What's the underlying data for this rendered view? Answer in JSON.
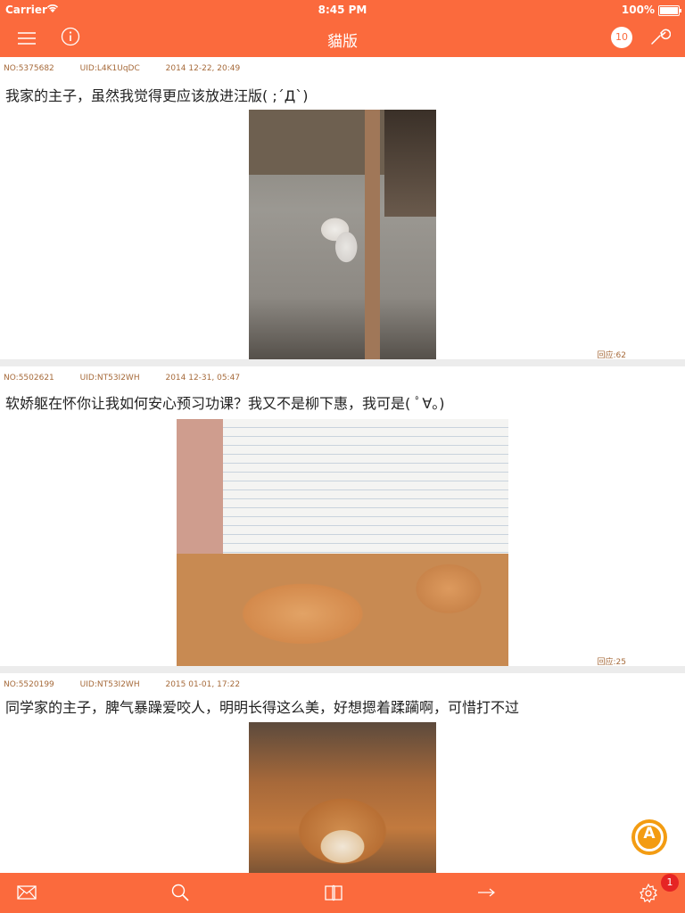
{
  "status_bar": {
    "carrier": "Carrier",
    "time": "8:45 PM",
    "battery": "100%"
  },
  "nav_bar": {
    "title": "貓版",
    "notification_count": "10"
  },
  "posts": [
    {
      "no": "NO:5375682",
      "uid": "UID:L4K1UqDC",
      "date": "2014 12-22, 20:49",
      "text": "我家的主子，虽然我觉得更应该放进汪版( ;´Д`)",
      "replies": "回应:62"
    },
    {
      "no": "NO:5502621",
      "uid": "UID:NT53I2WH",
      "date": "2014 12-31, 05:47",
      "text": "软娇躯在怀你让我如何安心预习功课？我又不是柳下惠，我可是( ﾟ∀。)",
      "replies": "回应:25"
    },
    {
      "no": "NO:5520199",
      "uid": "UID:NT53I2WH",
      "date": "2015 01-01, 17:22",
      "text": "同学家的主子，脾气暴躁爱咬人，明明长得这么美，好想摁着蹂躏啊，可惜打不过"
    }
  ],
  "floating_button": {
    "letter": "A"
  },
  "tab_bar": {
    "settings_badge": "1"
  }
}
